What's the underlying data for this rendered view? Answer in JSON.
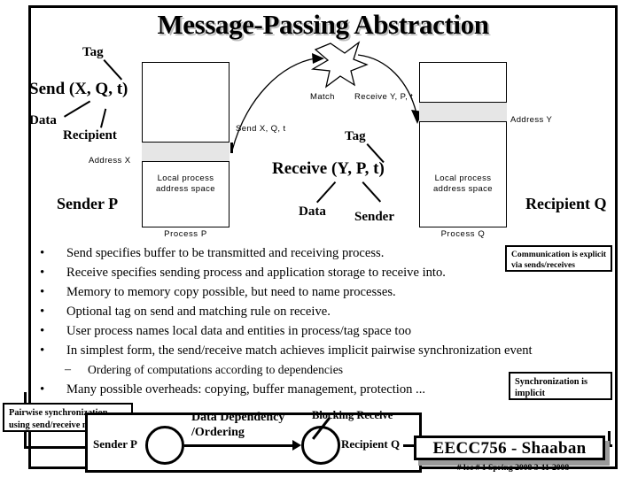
{
  "slide": {
    "title": "Message-Passing Abstraction"
  },
  "sender_side": {
    "tag_label": "Tag",
    "send_signature": "Send (X, Q, t)",
    "data_label": "Data",
    "recipient_label": "Recipient",
    "address_label": "Address X",
    "box_inner_line1": "Local process",
    "box_inner_line2": "address space",
    "box_caption": "Process P",
    "actor_label": "Sender P",
    "arrow_label": "Send X, Q, t"
  },
  "match": {
    "star_label": "Match",
    "arrow_label": "Receive Y, P, t"
  },
  "receiver_side": {
    "tag_label": "Tag",
    "receive_signature": "Receive (Y, P, t)",
    "data_label": "Data",
    "sender_label": "Sender",
    "address_label": "Address Y",
    "box_inner_line1": "Local process",
    "box_inner_line2": "address space",
    "box_caption": "Process Q",
    "actor_label": "Recipient Q"
  },
  "bullets": [
    {
      "mark": "•",
      "text": "Send specifies buffer to be transmitted and receiving process."
    },
    {
      "mark": "•",
      "text": "Receive specifies sending process and application storage to receive into."
    },
    {
      "mark": "•",
      "text": "Memory to memory copy possible, but need to name processes."
    },
    {
      "mark": "•",
      "text": "Optional tag on send and matching rule on receive."
    },
    {
      "mark": "•",
      "text": "User process names local data and entities in process/tag space too"
    },
    {
      "mark": "•",
      "text": "In simplest form, the send/receive match achieves implicit pairwise synchronization event"
    }
  ],
  "sub_bullet": {
    "mark": "–",
    "text": "Ordering of computations according to dependencies"
  },
  "last_bullet": {
    "mark": "•",
    "text": "Many possible overheads: copying, buffer management, protection ..."
  },
  "notes": {
    "communication": "Communication is explicit\nvia sends/receives",
    "communication_line1": "Communication is explicit",
    "communication_line2": "via sends/receives",
    "synchronization_line1": "Synchronization is",
    "synchronization_line2": "implicit",
    "pairwise_line1": "Pairwise synchronization",
    "pairwise_line2": "using send/receive match"
  },
  "bottom_diagram": {
    "sender_label": "Sender P",
    "recipient_label": "Recipient Q",
    "dependency_line1": "Data Dependency",
    "dependency_line2": "/Ordering",
    "blocking_label": "Blocking Receive"
  },
  "footer": {
    "course": "EECC756 - Shaaban",
    "meta": "#  lec # 1     Spring 2008   3-11-2008"
  },
  "colors": {
    "band_gray": "#e6e6e6",
    "title_shadow": "#bdbdbd",
    "ink": "#000000",
    "footer_shadow": "#9a9a9a"
  }
}
